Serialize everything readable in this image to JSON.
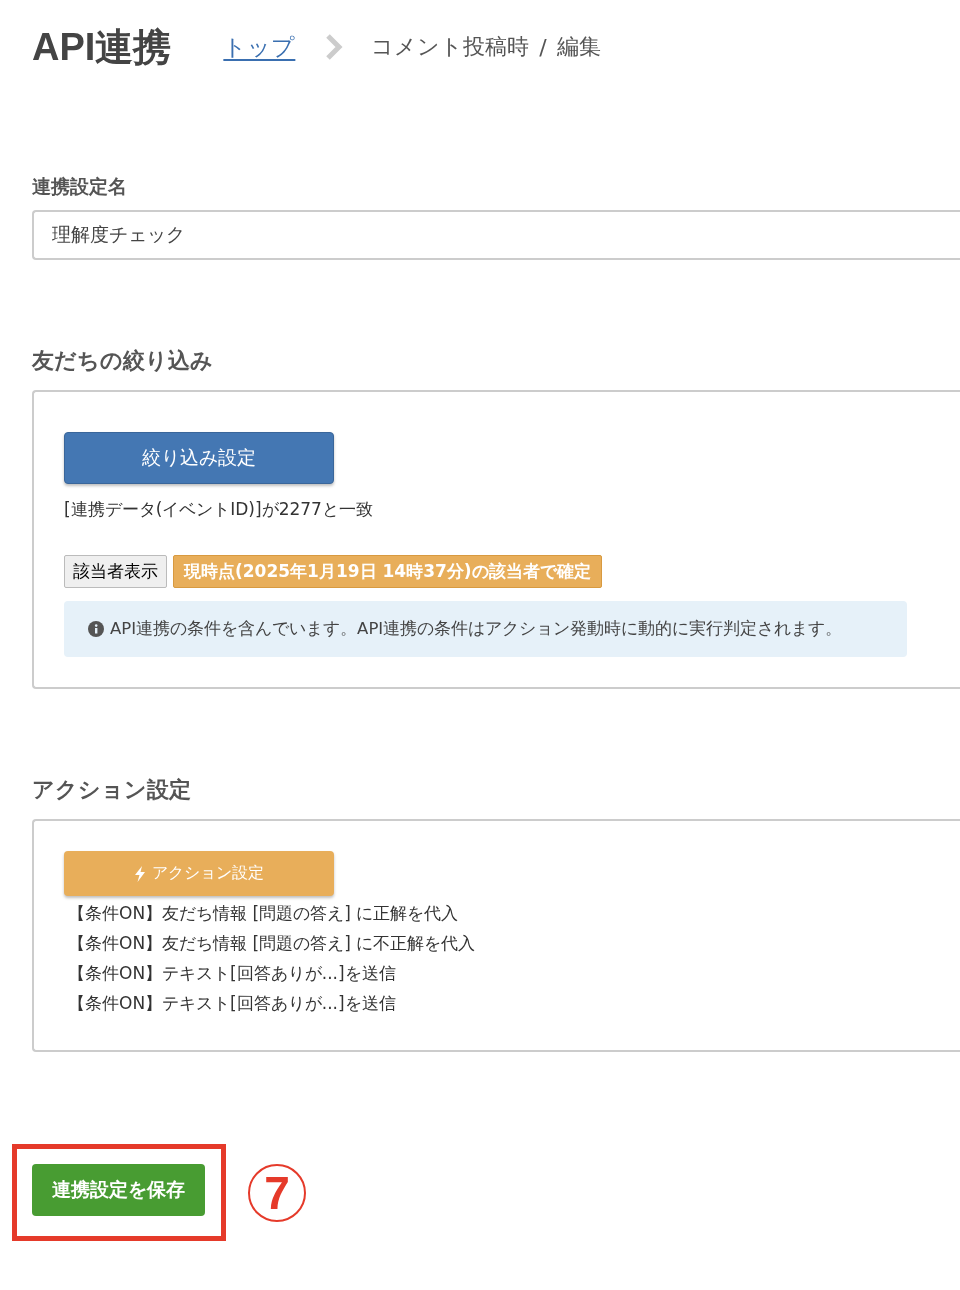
{
  "header": {
    "title": "API連携",
    "breadcrumb": [
      {
        "label": "トップ",
        "kind": "link"
      },
      {
        "label": "コメント投稿時",
        "kind": "text"
      },
      {
        "label": "編集",
        "kind": "text"
      }
    ],
    "separator": "/"
  },
  "name_field": {
    "label": "連携設定名",
    "value": "理解度チェック"
  },
  "filter": {
    "heading": "友だちの絞り込み",
    "button": "絞り込み設定",
    "condition": "[連携データ(イベントID)]が2277と一致",
    "show_button": "該当者表示",
    "confirm_tag": "現時点(2025年1月19日 14時37分)の該当者で確定",
    "notice": "API連携の条件を含んでいます。API連携の条件はアクション発動時に動的に実行判定されます。"
  },
  "action": {
    "heading": "アクション設定",
    "button": "アクション設定",
    "items": [
      "【条件ON】友だち情報 [問題の答え] に正解を代入",
      "【条件ON】友だち情報 [問題の答え] に不正解を代入",
      "【条件ON】テキスト[回答ありが...]を送信",
      "【条件ON】テキスト[回答ありが...]を送信"
    ]
  },
  "save_button": {
    "label": "連携設定を保存",
    "highlighted": true
  },
  "step_marker": "7"
}
